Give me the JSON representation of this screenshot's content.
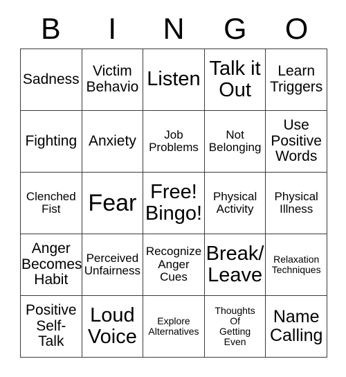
{
  "card": {
    "title": "BINGO",
    "header_letters": [
      "B",
      "I",
      "N",
      "G",
      "O"
    ],
    "columns": 5,
    "rows": 5,
    "free_space_index": 12,
    "colors": {
      "background": "#ffffff",
      "text": "#000000",
      "border": "#3a3a3a"
    },
    "cells": [
      {
        "text": "Sadness",
        "size": "md",
        "free": false
      },
      {
        "text": "Victim\nBehavio",
        "size": "md",
        "free": false
      },
      {
        "text": "Listen",
        "size": "xl",
        "free": false
      },
      {
        "text": "Talk it\nOut",
        "size": "xl",
        "free": false
      },
      {
        "text": "Learn\nTriggers",
        "size": "md",
        "free": false
      },
      {
        "text": "Fighting",
        "size": "md",
        "free": false
      },
      {
        "text": "Anxiety",
        "size": "md",
        "free": false
      },
      {
        "text": "Job\nProblems",
        "size": "sm",
        "free": false
      },
      {
        "text": "Not\nBelonging",
        "size": "sm",
        "free": false
      },
      {
        "text": "Use\nPositive\nWords",
        "size": "md",
        "free": false
      },
      {
        "text": "Clenched\nFist",
        "size": "sm",
        "free": false
      },
      {
        "text": "Fear",
        "size": "xxl",
        "free": false
      },
      {
        "text": "Free!\nBingo!",
        "size": "xl",
        "free": true
      },
      {
        "text": "Physical\nActivity",
        "size": "sm",
        "free": false
      },
      {
        "text": "Physical\nIllness",
        "size": "sm",
        "free": false
      },
      {
        "text": "Anger\nBecomes\nHabit",
        "size": "md",
        "free": false
      },
      {
        "text": "Perceived\nUnfairness",
        "size": "sm",
        "free": false
      },
      {
        "text": "Recognize\nAnger\nCues",
        "size": "sm",
        "free": false
      },
      {
        "text": "Break/\nLeave",
        "size": "xl",
        "free": false
      },
      {
        "text": "Relaxation\nTechniques",
        "size": "xs",
        "free": false
      },
      {
        "text": "Positive\nSelf-\nTalk",
        "size": "md",
        "free": false
      },
      {
        "text": "Loud\nVoice",
        "size": "xl",
        "free": false
      },
      {
        "text": "Explore\nAlternatives",
        "size": "xs",
        "free": false
      },
      {
        "text": "Thoughts\nOf\nGetting\nEven",
        "size": "xs",
        "free": false
      },
      {
        "text": "Name\nCalling",
        "size": "lg",
        "free": false
      }
    ]
  }
}
